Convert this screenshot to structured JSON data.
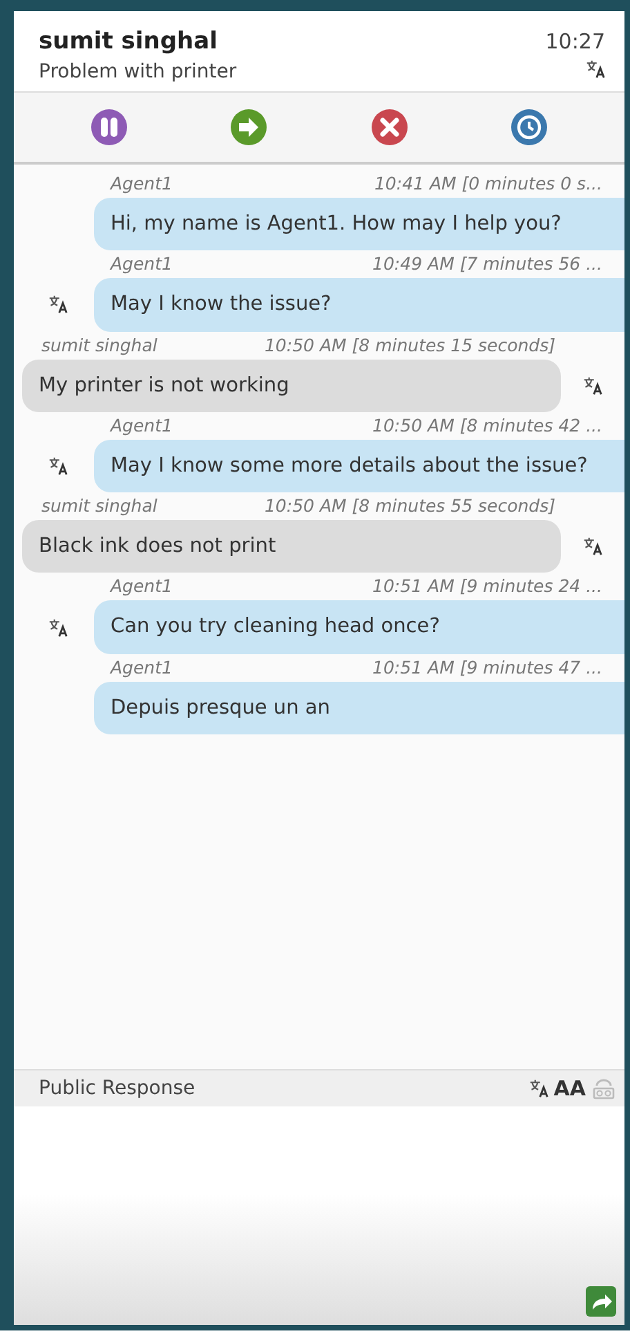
{
  "header": {
    "customer_name": "sumit singhal",
    "time": "10:27",
    "subject": "Problem with printer"
  },
  "toolbar": [
    {
      "kind": "hold"
    },
    {
      "kind": "transfer"
    },
    {
      "kind": "end"
    },
    {
      "kind": "history"
    }
  ],
  "messages": [
    {
      "kind": "agent",
      "sender": "Agent1",
      "time": "10:41 AM [0 minutes 0 s...",
      "text": "Hi, my name is Agent1. How may I help you?",
      "translatable": false
    },
    {
      "kind": "agent",
      "sender": "Agent1",
      "time": "10:49 AM [7 minutes 56 ...",
      "text": "May I know the issue?",
      "translatable": true
    },
    {
      "kind": "customer",
      "sender": "sumit singhal",
      "time": "10:50 AM [8 minutes 15 seconds]",
      "text": "My printer is not working",
      "translatable": true
    },
    {
      "kind": "agent",
      "sender": "Agent1",
      "time": "10:50 AM [8 minutes 42 ...",
      "text": "May I know some more details about the issue?",
      "translatable": true
    },
    {
      "kind": "customer",
      "sender": "sumit singhal",
      "time": "10:50 AM [8 minutes 55 seconds]",
      "text": "Black ink does not print",
      "translatable": true
    },
    {
      "kind": "agent",
      "sender": "Agent1",
      "time": "10:51 AM [9 minutes 24 ...",
      "text": "Can you try cleaning head once?",
      "translatable": true
    },
    {
      "kind": "agent",
      "sender": "Agent1",
      "time": "10:51 AM [9 minutes 47 ...",
      "text": "Depuis presque un an",
      "translatable": false
    }
  ],
  "composer": {
    "label": "Public Response",
    "font_size_label": "AA"
  }
}
